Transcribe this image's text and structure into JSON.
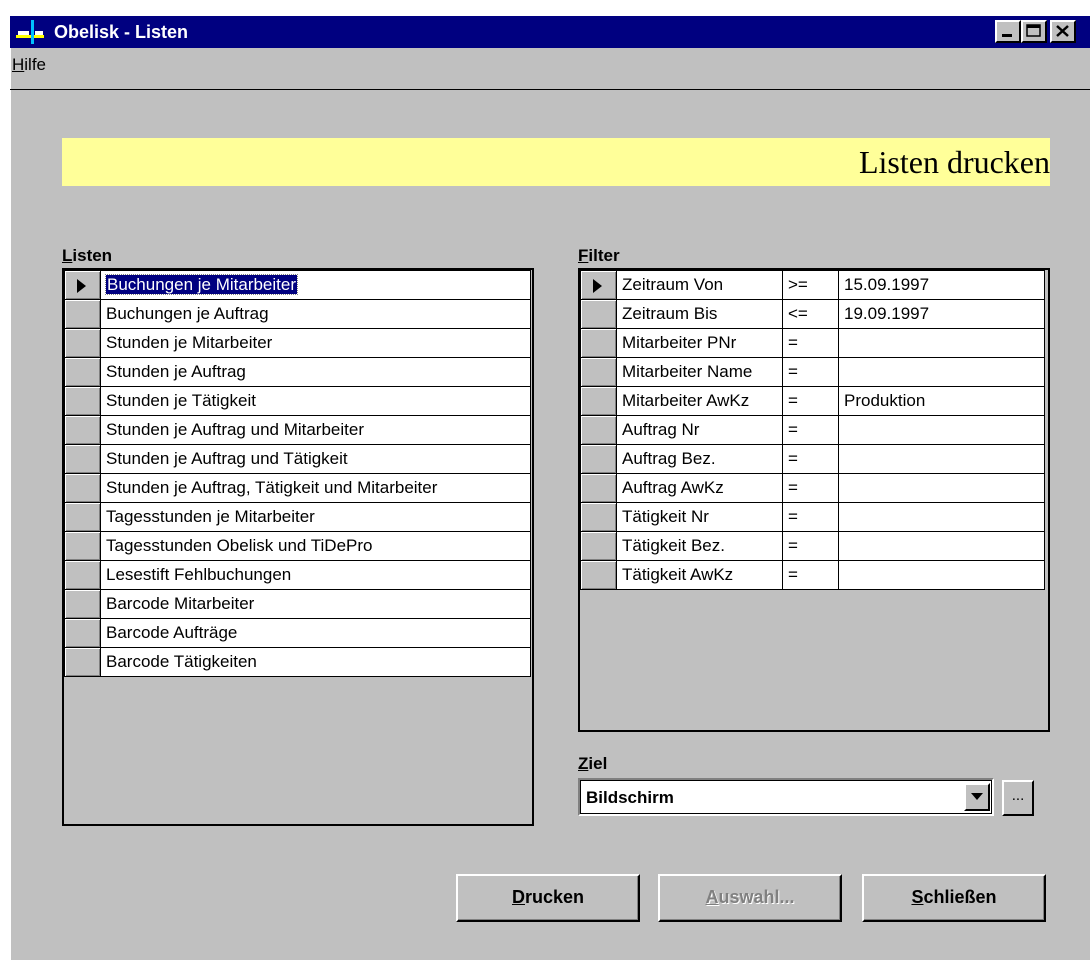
{
  "window": {
    "title": "Obelisk - Listen"
  },
  "menu": {
    "items": [
      {
        "accel": "H",
        "rest": "ilfe"
      }
    ]
  },
  "banner": {
    "text": "Listen drucken"
  },
  "lists": {
    "label_accel": "L",
    "label_rest": "isten",
    "selected_index": 0,
    "items": [
      "Buchungen je Mitarbeiter",
      "Buchungen je Auftrag",
      "Stunden je Mitarbeiter",
      "Stunden je Auftrag",
      "Stunden je Tätigkeit",
      "Stunden je Auftrag und Mitarbeiter",
      "Stunden je Auftrag und Tätigkeit",
      "Stunden je Auftrag, Tätigkeit und Mitarbeiter",
      "Tagesstunden je Mitarbeiter",
      "Tagesstunden Obelisk und TiDePro",
      "Lesestift Fehlbuchungen",
      "Barcode Mitarbeiter",
      "Barcode Aufträge",
      "Barcode Tätigkeiten"
    ]
  },
  "filter": {
    "label_accel": "F",
    "label_rest": "ilter",
    "selected_index": 0,
    "rows": [
      {
        "field": "Zeitraum Von",
        "op": ">=",
        "value": "15.09.1997"
      },
      {
        "field": "Zeitraum Bis",
        "op": "<=",
        "value": "19.09.1997"
      },
      {
        "field": "Mitarbeiter PNr",
        "op": "=",
        "value": ""
      },
      {
        "field": "Mitarbeiter Name",
        "op": "=",
        "value": ""
      },
      {
        "field": "Mitarbeiter AwKz",
        "op": "=",
        "value": "Produktion"
      },
      {
        "field": "Auftrag Nr",
        "op": "=",
        "value": ""
      },
      {
        "field": "Auftrag Bez.",
        "op": "=",
        "value": ""
      },
      {
        "field": "Auftrag AwKz",
        "op": "=",
        "value": ""
      },
      {
        "field": "Tätigkeit Nr",
        "op": "=",
        "value": ""
      },
      {
        "field": "Tätigkeit Bez.",
        "op": "=",
        "value": ""
      },
      {
        "field": "Tätigkeit AwKz",
        "op": "=",
        "value": ""
      }
    ]
  },
  "target": {
    "label_accel": "Z",
    "label_rest": "iel",
    "value": "Bildschirm",
    "browse_label": "..."
  },
  "buttons": {
    "print": {
      "accel": "D",
      "rest": "rucken"
    },
    "select": {
      "accel": "A",
      "rest": "uswahl..."
    },
    "close": {
      "accel": "S",
      "rest": "chließen"
    }
  },
  "colors": {
    "titlebar": "#000080",
    "face": "#c0c0c0",
    "banner": "#ffff99",
    "selection": "#000080"
  }
}
